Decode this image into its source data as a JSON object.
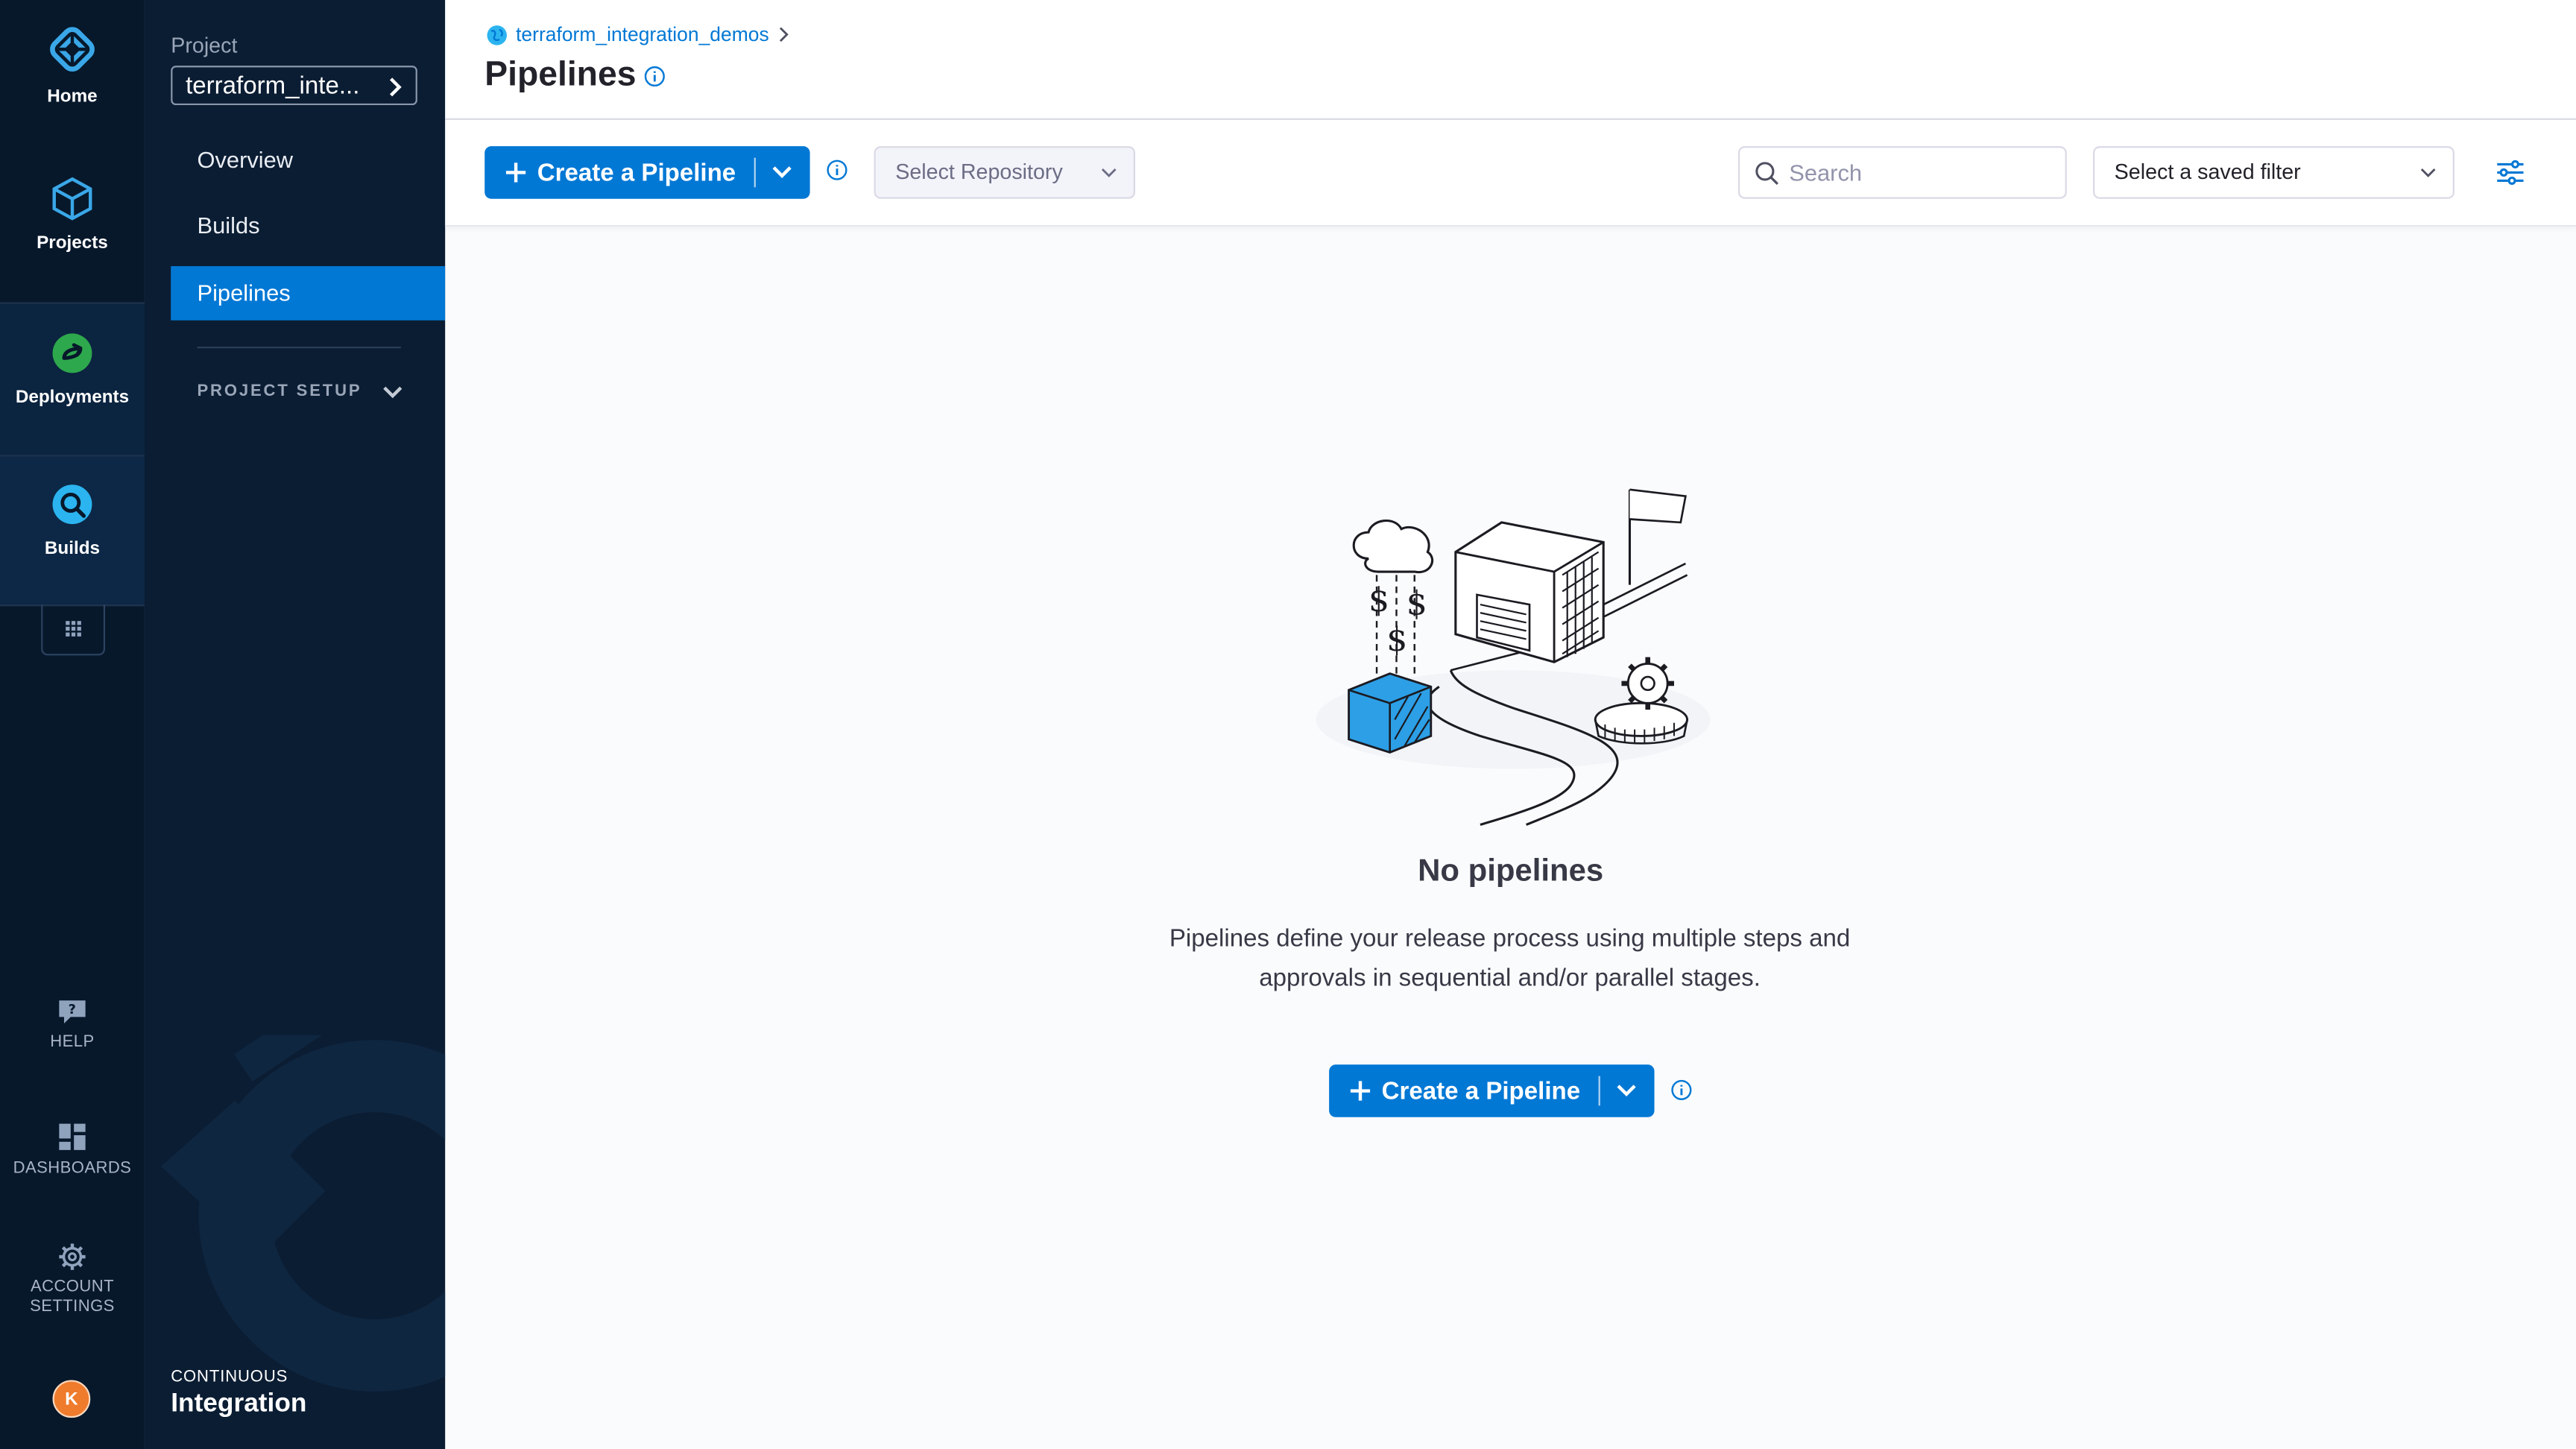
{
  "rail": {
    "home": "Home",
    "projects": "Projects",
    "deployments": "Deployments",
    "builds": "Builds",
    "help": "HELP",
    "dashboards": "DASHBOARDS",
    "account_settings_line1": "ACCOUNT",
    "account_settings_line2": "SETTINGS",
    "avatar_initial": "K"
  },
  "subnav": {
    "project_label": "Project",
    "project_name": "terraform_inte...",
    "items": [
      "Overview",
      "Builds",
      "Pipelines"
    ],
    "active_item": "Pipelines",
    "project_setup": "PROJECT SETUP",
    "module_sub": "CONTINUOUS",
    "module_name": "Integration"
  },
  "header": {
    "breadcrumb": "terraform_integration_demos",
    "title": "Pipelines"
  },
  "toolbar": {
    "create_label": "Create a Pipeline",
    "repo_placeholder": "Select Repository",
    "search_placeholder": "Search",
    "saved_filter": "Select a saved filter"
  },
  "empty": {
    "title": "No pipelines",
    "desc_line1": "Pipelines define your release process using multiple steps and",
    "desc_line2": "approvals in sequential and/or parallel stages.",
    "create_label": "Create a Pipeline"
  },
  "colors": {
    "primary": "#0278d5",
    "nav_bg": "#07182b",
    "subnav_bg": "#0b1d33",
    "deployments_green": "#2ea84d",
    "builds_blue": "#2bb4f0",
    "avatar": "#ef7b2c"
  }
}
